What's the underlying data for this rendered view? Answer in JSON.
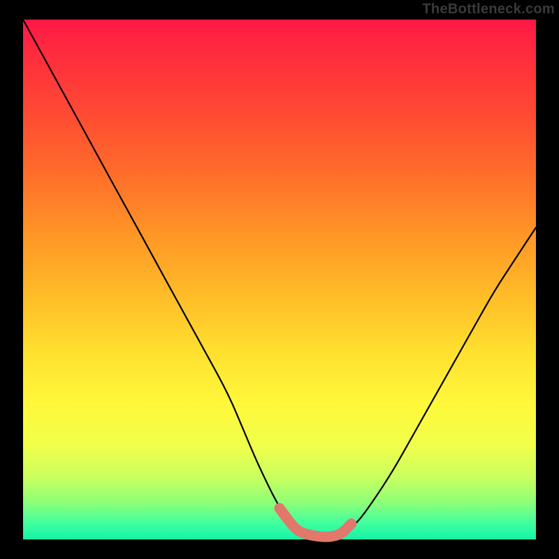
{
  "watermark": "TheBottleneck.com",
  "chart_data": {
    "type": "line",
    "title": "",
    "xlabel": "",
    "ylabel": "",
    "xlim": [
      0,
      100
    ],
    "ylim": [
      0,
      100
    ],
    "legend": false,
    "grid": false,
    "background": "rainbow-gradient-vertical-red-to-green",
    "series": [
      {
        "name": "bottleneck-curve",
        "x": [
          0,
          5,
          10,
          15,
          20,
          25,
          30,
          35,
          40,
          43,
          46,
          50,
          53,
          55,
          58,
          60,
          62,
          65,
          68,
          72,
          76,
          80,
          84,
          88,
          92,
          96,
          100
        ],
        "y": [
          100,
          91,
          82,
          73,
          64,
          55,
          46,
          37,
          28,
          21,
          14,
          6,
          2,
          1,
          0.5,
          0.5,
          1,
          3,
          7,
          13,
          20,
          27,
          34,
          41,
          48,
          54,
          60
        ]
      }
    ],
    "highlight": {
      "name": "bottleneck-floor",
      "x": [
        50,
        53,
        55,
        58,
        60,
        62,
        64
      ],
      "y": [
        6,
        2,
        1,
        0.5,
        0.5,
        1,
        3
      ],
      "color": "#e2776b"
    }
  }
}
